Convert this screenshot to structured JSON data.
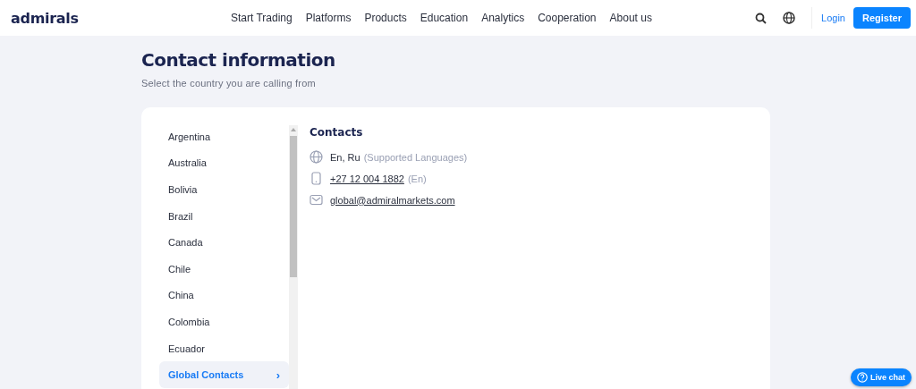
{
  "header": {
    "logo": "admirals",
    "nav": [
      "Start Trading",
      "Platforms",
      "Products",
      "Education",
      "Analytics",
      "Cooperation",
      "About us"
    ],
    "login": "Login",
    "register": "Register"
  },
  "page": {
    "title": "Contact information",
    "subtitle": "Select the country you are calling from"
  },
  "countries": [
    {
      "label": "Argentina",
      "selected": false
    },
    {
      "label": "Australia",
      "selected": false
    },
    {
      "label": "Bolivia",
      "selected": false
    },
    {
      "label": "Brazil",
      "selected": false
    },
    {
      "label": "Canada",
      "selected": false
    },
    {
      "label": "Chile",
      "selected": false
    },
    {
      "label": "China",
      "selected": false
    },
    {
      "label": "Colombia",
      "selected": false
    },
    {
      "label": "Ecuador",
      "selected": false
    },
    {
      "label": "Global Contacts",
      "selected": true,
      "chevron": "›"
    }
  ],
  "contacts": {
    "heading": "Contacts",
    "rows": [
      {
        "kind": "languages",
        "value": "En, Ru",
        "note": "(Supported Languages)"
      },
      {
        "kind": "phone",
        "value": "+27 12 004 1882",
        "note": "(En)"
      },
      {
        "kind": "email",
        "value": "global@admiralmarkets.com"
      }
    ]
  },
  "live_chat": {
    "label": "Live chat"
  }
}
